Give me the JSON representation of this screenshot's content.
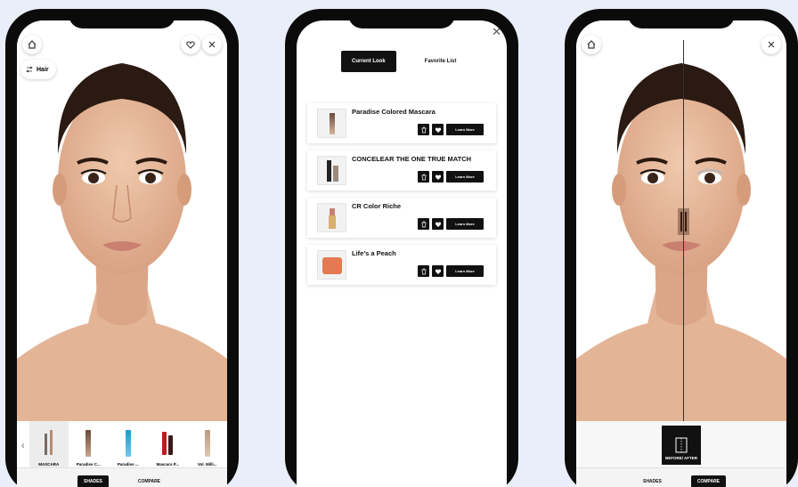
{
  "left_screen": {
    "hair_label": "Hair",
    "products": [
      {
        "label": "MASCARA",
        "selected": true
      },
      {
        "label": "Paradise C...",
        "selected": false
      },
      {
        "label": "Paradise ...",
        "selected": false
      },
      {
        "label": "Mascara P...",
        "selected": false
      },
      {
        "label": "Vol. Milli...",
        "selected": false
      }
    ],
    "tabs": {
      "shades": "SHADES",
      "compare": "COMPARE"
    },
    "active_tab": "shades"
  },
  "middle_screen": {
    "tabs": {
      "current_look": "Current Look",
      "favorite_list": "Favorite List"
    },
    "active_tab": "current_look",
    "items": [
      {
        "name": "Paradise Colored Mascara",
        "button": "Learn More",
        "image": "mascara-tube"
      },
      {
        "name": "CONCELEAR THE ONE TRUE MATCH",
        "button": "Learn More",
        "image": "concealer-wand"
      },
      {
        "name": "CR Color Riche",
        "button": "Learn More",
        "image": "lipstick"
      },
      {
        "name": "Life's a Peach",
        "button": "Learn More",
        "image": "blush-compact"
      }
    ]
  },
  "right_screen": {
    "before_after_label": "BEFORE/ AFTER",
    "tabs": {
      "shades": "SHADES",
      "compare": "COMPARE"
    },
    "active_tab": "compare"
  },
  "colors": {
    "background": "#e9eef8",
    "phone_frame": "#0b0b0b",
    "skin": "#e9bfa2",
    "active_button": "#111111"
  }
}
